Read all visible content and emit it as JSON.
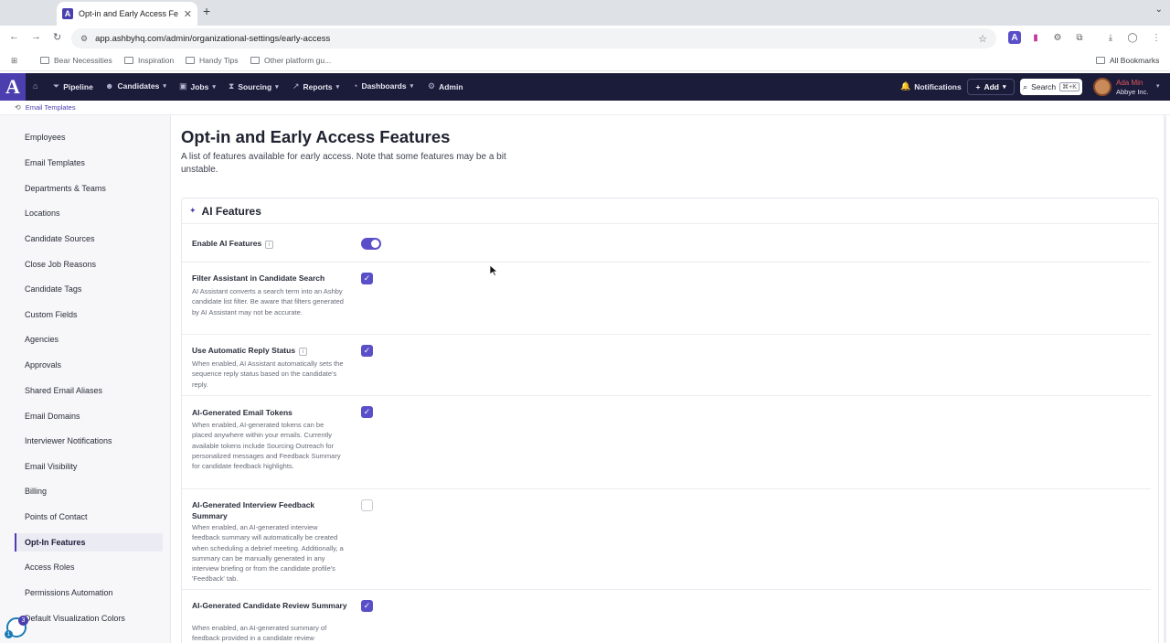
{
  "browser": {
    "tab_title": "Opt-in and Early Access Feat",
    "new_tab": "+",
    "url": "app.ashbyhq.com/admin/organizational-settings/early-access",
    "bookmarks": [
      "Bear Necessities",
      "Inspiration",
      "Handy Tips",
      "Other platform gu..."
    ],
    "all_bookmarks": "All Bookmarks"
  },
  "appnav": {
    "logo": "A",
    "items": [
      "Pipeline",
      "Candidates",
      "Jobs",
      "Sourcing",
      "Reports",
      "Dashboards",
      "Admin"
    ],
    "notifications": "Notifications",
    "add": "Add",
    "search": "Search",
    "search_shortcut": "⌘+K",
    "user_name": "Ada Min",
    "user_org": "Abbye Inc."
  },
  "breadcrumb": {
    "label": "Email Templates"
  },
  "sidebar": {
    "items": [
      "Employees",
      "Email Templates",
      "Departments & Teams",
      "Locations",
      "Candidate Sources",
      "Close Job Reasons",
      "Candidate Tags",
      "Custom Fields",
      "Agencies",
      "Approvals",
      "Shared Email Aliases",
      "Email Domains",
      "Interviewer Notifications",
      "Email Visibility",
      "Billing",
      "Points of Contact",
      "Opt-In Features",
      "Access Roles",
      "Permissions Automation",
      "Default Visualization Colors"
    ],
    "active": "Opt-In Features",
    "help_badge_count": "3",
    "help_badge_count2": "1"
  },
  "page": {
    "title": "Opt-in and Early Access Features",
    "description": "A list of features available for early access. Note that some features may be a bit unstable."
  },
  "section": {
    "title": "AI Features",
    "features": [
      {
        "label": "Enable AI Features",
        "info": "i",
        "description": "",
        "control": "toggle",
        "enabled": true
      },
      {
        "label": "Filter Assistant in Candidate Search",
        "description": "AI Assistant converts a search term into an Ashby candidate list filter. Be aware that filters generated by AI Assistant may not be accurate.",
        "control": "checkbox",
        "enabled": true
      },
      {
        "label": "Use Automatic Reply Status",
        "info": "i",
        "description": "When enabled, AI Assistant automatically sets the sequence reply status based on the candidate's reply.",
        "control": "checkbox",
        "enabled": true
      },
      {
        "label": "AI-Generated Email Tokens",
        "description": "When enabled, AI-generated tokens can be placed anywhere within your emails. Currently available tokens include Sourcing Outreach for personalized messages and Feedback Summary for candidate feedback highlights.",
        "control": "checkbox",
        "enabled": true
      },
      {
        "label": "AI-Generated Interview Feedback Summary",
        "description": "When enabled, an AI-generated interview feedback summary will automatically be created when scheduling a debrief meeting. Additionally, a summary can be manually generated in any interview briefing or from the candidate profile's 'Feedback' tab.",
        "control": "checkbox",
        "enabled": false
      },
      {
        "label": "AI-Generated Candidate Review Summary",
        "description": "When enabled, an AI-generated summary of feedback provided in a candidate review",
        "control": "checkbox",
        "enabled": true
      }
    ]
  },
  "colors": {
    "accent": "#5a4fc8",
    "nav_bg": "#1b1b3a",
    "brand": "#4b3fb0"
  }
}
